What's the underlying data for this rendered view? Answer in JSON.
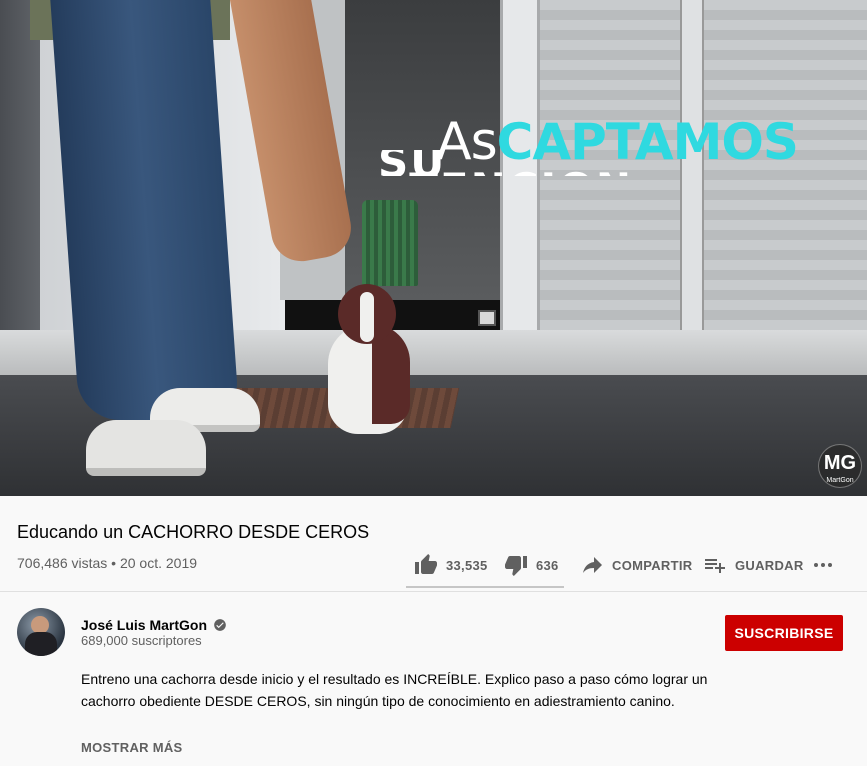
{
  "player": {
    "overlay_word_white": "As",
    "overlay_word_cyan": "CAPTAMOS",
    "overlay_ghost_text": "SU ATENCION",
    "watermark_logo": "MG",
    "watermark_name": "MartGon"
  },
  "video": {
    "title": "Educando un CACHORRO DESDE CEROS",
    "meta": "706,486 vistas • 20 oct. 2019",
    "likes": "33,535",
    "dislikes": "636",
    "like_ratio": 0.981,
    "share_label": "COMPARTIR",
    "save_label": "GUARDAR"
  },
  "channel": {
    "name": "José Luis MartGon",
    "subscribers": "689,000 suscriptores",
    "verified": true,
    "subscribe_label": "SUSCRIBIRSE"
  },
  "description": {
    "text": "Entreno una cachorra desde inicio y el resultado es INCREÍBLE. Explico paso a paso cómo lograr un cachorro obediente DESDE CEROS, sin ningún tipo de conocimiento en adiestramiento canino.",
    "show_more_label": "MOSTRAR MÁS"
  },
  "colors": {
    "accent_red": "#cc0000",
    "overlay_cyan": "#2fd9e0",
    "text_secondary": "#606060"
  },
  "icons": {
    "like": "thumbs-up-icon",
    "dislike": "thumbs-down-icon",
    "share": "share-arrow-icon",
    "save": "playlist-add-icon",
    "more": "more-horizontal-icon",
    "verified": "check-circle-icon"
  }
}
